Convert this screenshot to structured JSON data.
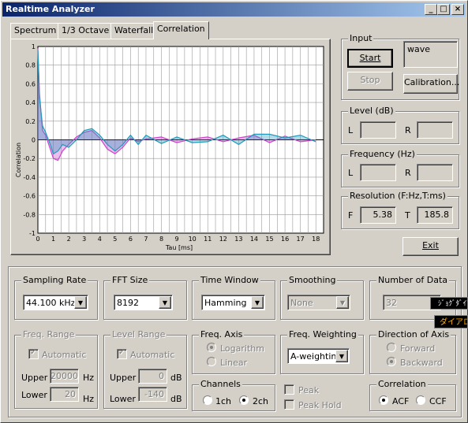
{
  "window": {
    "title": "Realtime Analyzer"
  },
  "tabs": [
    "Spectrum",
    "1/3 Octave",
    "Waterfall",
    "Correlation"
  ],
  "chart_data": {
    "type": "line",
    "ylabel": "Correlation",
    "xlabel": "Tau [ms]",
    "xlim": [
      0,
      18.5
    ],
    "ylim": [
      -1,
      1
    ],
    "xticks": [
      "0",
      "1",
      "2",
      "3",
      "4",
      "5",
      "6",
      "7",
      "8",
      "9",
      "10",
      "11",
      "12",
      "13",
      "14",
      "15",
      "16",
      "17",
      "18"
    ],
    "yticks": [
      "1",
      "0.8",
      "0.6",
      "0.4",
      "0.2",
      "0",
      "-0.2",
      "-0.4",
      "-0.6",
      "-0.8",
      "-1"
    ],
    "grid": true,
    "series": [
      {
        "color": "#cc44cc",
        "x": [
          0,
          0.1,
          0.3,
          0.5,
          0.8,
          1.0,
          1.3,
          1.6,
          2.0,
          2.5,
          3.0,
          3.5,
          4.0,
          4.5,
          5.0,
          5.5,
          6.0,
          6.5,
          7.0,
          8.0,
          9.0,
          10.0,
          11.0,
          12.0,
          13.0,
          14.0,
          15.0,
          16.0,
          17.0,
          18.0
        ],
        "y": [
          0.98,
          0.5,
          0.1,
          0.05,
          -0.1,
          -0.2,
          -0.22,
          -0.12,
          -0.05,
          0.03,
          0.08,
          0.1,
          0.02,
          -0.1,
          -0.15,
          -0.08,
          0.02,
          -0.02,
          0.01,
          0.03,
          -0.03,
          0.01,
          0.03,
          -0.02,
          0.02,
          0.05,
          -0.03,
          0.04,
          -0.02,
          0.0
        ]
      },
      {
        "color": "#2299bb",
        "x": [
          0,
          0.1,
          0.3,
          0.5,
          0.8,
          1.0,
          1.3,
          1.6,
          2.0,
          2.5,
          3.0,
          3.5,
          4.0,
          4.5,
          5.0,
          5.5,
          6.0,
          6.5,
          7.0,
          8.0,
          9.0,
          10.0,
          11.0,
          12.0,
          13.0,
          14.0,
          15.0,
          16.0,
          17.0,
          18.0
        ],
        "y": [
          0.96,
          0.45,
          0.15,
          0.08,
          -0.05,
          -0.15,
          -0.12,
          -0.05,
          -0.08,
          0.0,
          0.1,
          0.12,
          0.05,
          -0.05,
          -0.12,
          -0.05,
          0.05,
          -0.05,
          0.05,
          -0.04,
          0.03,
          -0.03,
          -0.02,
          0.05,
          -0.05,
          0.06,
          0.06,
          0.02,
          0.05,
          -0.02
        ]
      }
    ]
  },
  "input": {
    "label": "Input",
    "start": "Start",
    "stop": "Stop",
    "calibration": "Calibration...",
    "source": "wave"
  },
  "level": {
    "label": "Level (dB)",
    "l": "L",
    "r": "R"
  },
  "frequency": {
    "label": "Frequency (Hz)",
    "l": "L",
    "r": "R"
  },
  "resolution": {
    "label": "Resolution (F:Hz,T:ms)",
    "f": "F",
    "f_val": "5.38",
    "t": "T",
    "t_val": "185.8"
  },
  "exit": "Exit",
  "sampling_rate": {
    "label": "Sampling Rate",
    "value": "44.100 kHz"
  },
  "fft_size": {
    "label": "FFT Size",
    "value": "8192"
  },
  "time_window": {
    "label": "Time Window",
    "value": "Hamming"
  },
  "smoothing": {
    "label": "Smoothing",
    "value": "None"
  },
  "number_of_data": {
    "label": "Number of Data",
    "value": "32"
  },
  "ime_popup": {
    "line1": "ｼﾞｮｸﾞﾀﾞｲｱ",
    "line2": "ダイアロ"
  },
  "freq_range": {
    "label": "Freq. Range",
    "automatic": "Automatic",
    "upper": "Upper",
    "upper_val": "20000",
    "lower": "Lower",
    "lower_val": "20",
    "unit": "Hz"
  },
  "level_range": {
    "label": "Level Range",
    "automatic": "Automatic",
    "upper": "Upper",
    "upper_val": "0",
    "lower": "Lower",
    "lower_val": "-140",
    "unit": "dB"
  },
  "freq_axis": {
    "label": "Freq. Axis",
    "log": "Logarithm",
    "linear": "Linear"
  },
  "freq_weighting": {
    "label": "Freq. Weighting",
    "value": "A-weighting"
  },
  "direction": {
    "label": "Direction of Axis",
    "forward": "Forward",
    "backward": "Backward"
  },
  "channels": {
    "label": "Channels",
    "ch1": "1ch",
    "ch2": "2ch"
  },
  "peak": "Peak",
  "peak_hold": "Peak Hold",
  "correlation": {
    "label": "Correlation",
    "acf": "ACF",
    "ccf": "CCF"
  }
}
